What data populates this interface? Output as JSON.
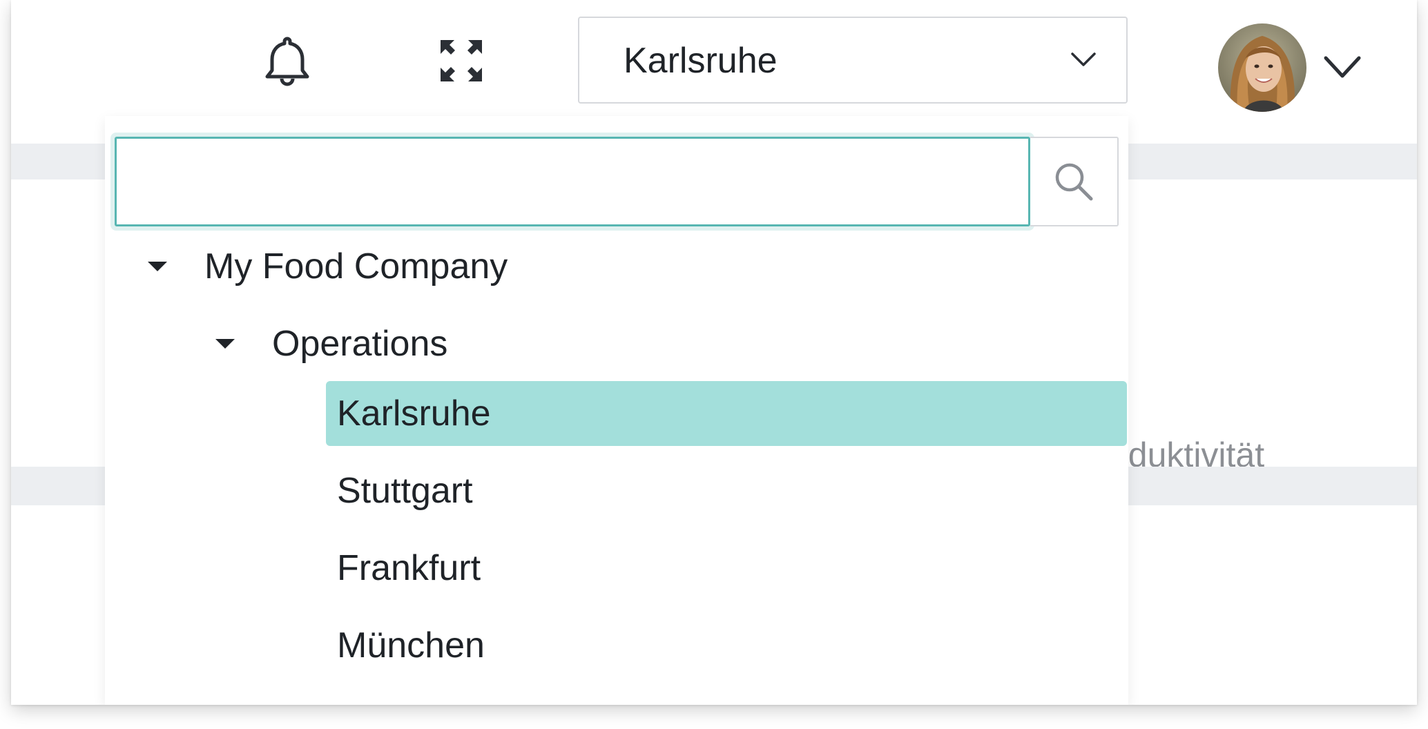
{
  "header": {
    "location_select": {
      "value": "Karlsruhe"
    },
    "icons": {
      "notifications": "bell-icon",
      "fullscreen": "expand-icon",
      "user_menu": "chevron-down-icon"
    }
  },
  "background": {
    "partial_text": "oduktivität"
  },
  "dropdown": {
    "search": {
      "value": "",
      "placeholder": ""
    },
    "tree": {
      "root": "My Food Company",
      "group": "Operations",
      "items": [
        {
          "label": "Karlsruhe",
          "selected": true
        },
        {
          "label": "Stuttgart",
          "selected": false
        },
        {
          "label": "Frankfurt",
          "selected": false
        },
        {
          "label": "München",
          "selected": false
        }
      ]
    }
  },
  "colors": {
    "accent": "#57b6b2",
    "selected_bg": "#a3dfdb",
    "text": "#1f2328"
  }
}
